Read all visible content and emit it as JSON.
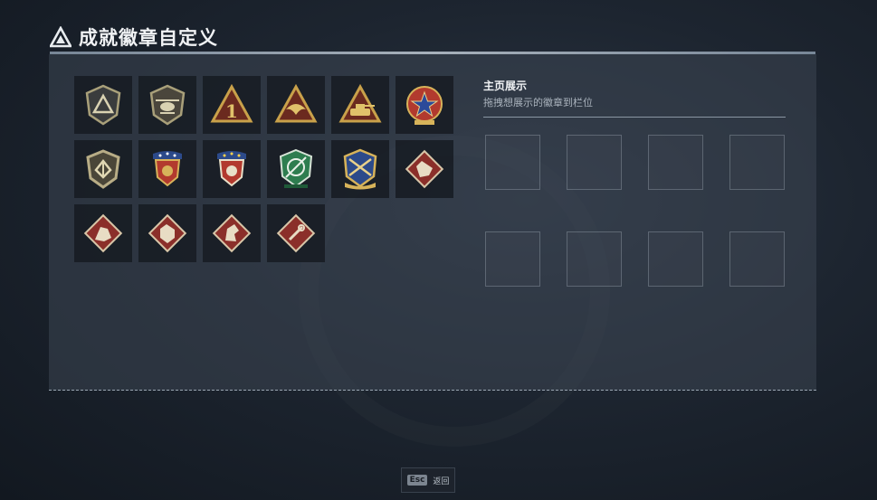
{
  "header": {
    "title": "成就徽章自定义",
    "icon": "triangle-logo-icon"
  },
  "badges": [
    {
      "icon": "shield-triangle-icon",
      "color": "#a9a07a"
    },
    {
      "icon": "helicopter-shield-icon",
      "color": "#a9a07a"
    },
    {
      "icon": "triangle-number-one-icon",
      "color": "#c9a14a"
    },
    {
      "icon": "triangle-eagle-icon",
      "color": "#c9a14a"
    },
    {
      "icon": "triangle-tank-icon",
      "color": "#c9a14a"
    },
    {
      "icon": "red-star-crest-icon",
      "color": "#c0392b"
    },
    {
      "icon": "shield-wings-icon",
      "color": "#b8ad86"
    },
    {
      "icon": "eagle-crest-red-icon",
      "color": "#c0392b"
    },
    {
      "icon": "eagle-crest-red-2-icon",
      "color": "#c0392b"
    },
    {
      "icon": "green-scope-crest-icon",
      "color": "#2e7d4f"
    },
    {
      "icon": "blue-crossed-rifles-crest-icon",
      "color": "#2c4a8a"
    },
    {
      "icon": "diamond-wolf-icon",
      "color": "#8b2f2a"
    },
    {
      "icon": "diamond-soldier-icon",
      "color": "#8b2f2a"
    },
    {
      "icon": "diamond-tiger-icon",
      "color": "#8b2f2a"
    },
    {
      "icon": "diamond-horse-icon",
      "color": "#8b2f2a"
    },
    {
      "icon": "diamond-tools-icon",
      "color": "#8b2f2a"
    }
  ],
  "showcase": {
    "title": "主页展示",
    "subtitle": "拖拽想展示的徽章到栏位",
    "slot_count": 8
  },
  "footer": {
    "key": "Esc",
    "label": "返回"
  }
}
